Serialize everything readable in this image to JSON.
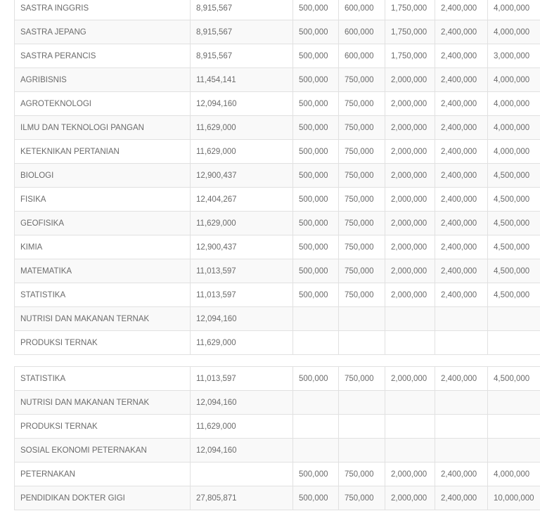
{
  "tables": [
    {
      "rows": [
        {
          "program": "SASTRA INGGRIS",
          "ukt": "8,915,567",
          "g1": "500,000",
          "g2": "600,000",
          "g3": "1,750,000",
          "g4": "2,400,000",
          "g5": "4,000,000"
        },
        {
          "program": "SASTRA JEPANG",
          "ukt": "8,915,567",
          "g1": "500,000",
          "g2": "600,000",
          "g3": "1,750,000",
          "g4": "2,400,000",
          "g5": "4,000,000"
        },
        {
          "program": "SASTRA PERANCIS",
          "ukt": "8,915,567",
          "g1": "500,000",
          "g2": "600,000",
          "g3": "1,750,000",
          "g4": "2,400,000",
          "g5": "3,000,000"
        },
        {
          "program": "AGRIBISNIS",
          "ukt": "11,454,141",
          "g1": "500,000",
          "g2": "750,000",
          "g3": "2,000,000",
          "g4": "2,400,000",
          "g5": "4,000,000"
        },
        {
          "program": "AGROTEKNOLOGI",
          "ukt": "12,094,160",
          "g1": "500,000",
          "g2": "750,000",
          "g3": "2,000,000",
          "g4": "2,400,000",
          "g5": "4,000,000"
        },
        {
          "program": "ILMU DAN TEKNOLOGI PANGAN",
          "ukt": "11,629,000",
          "g1": "500,000",
          "g2": "750,000",
          "g3": "2,000,000",
          "g4": "2,400,000",
          "g5": "4,000,000"
        },
        {
          "program": "KETEKNIKAN PERTANIAN",
          "ukt": "11,629,000",
          "g1": "500,000",
          "g2": "750,000",
          "g3": "2,000,000",
          "g4": "2,400,000",
          "g5": "4,000,000"
        },
        {
          "program": "BIOLOGI",
          "ukt": "12,900,437",
          "g1": "500,000",
          "g2": "750,000",
          "g3": "2,000,000",
          "g4": "2,400,000",
          "g5": "4,500,000"
        },
        {
          "program": "FISIKA",
          "ukt": "12,404,267",
          "g1": "500,000",
          "g2": "750,000",
          "g3": "2,000,000",
          "g4": "2,400,000",
          "g5": "4,500,000"
        },
        {
          "program": "GEOFISIKA",
          "ukt": "11,629,000",
          "g1": "500,000",
          "g2": "750,000",
          "g3": "2,000,000",
          "g4": "2,400,000",
          "g5": "4,500,000"
        },
        {
          "program": "KIMIA",
          "ukt": "12,900,437",
          "g1": "500,000",
          "g2": "750,000",
          "g3": "2,000,000",
          "g4": "2,400,000",
          "g5": "4,500,000"
        },
        {
          "program": "MATEMATIKA",
          "ukt": "11,013,597",
          "g1": "500,000",
          "g2": "750,000",
          "g3": "2,000,000",
          "g4": "2,400,000",
          "g5": "4,500,000"
        },
        {
          "program": "STATISTIKA",
          "ukt": "11,013,597",
          "g1": "500,000",
          "g2": "750,000",
          "g3": "2,000,000",
          "g4": "2,400,000",
          "g5": "4,500,000"
        },
        {
          "program": "NUTRISI DAN MAKANAN TERNAK",
          "ukt": "12,094,160",
          "g1": "",
          "g2": "",
          "g3": "",
          "g4": "",
          "g5": ""
        },
        {
          "program": "PRODUKSI TERNAK",
          "ukt": "11,629,000",
          "g1": "",
          "g2": "",
          "g3": "",
          "g4": "",
          "g5": ""
        }
      ]
    },
    {
      "rows": [
        {
          "program": "STATISTIKA",
          "ukt": "11,013,597",
          "g1": "500,000",
          "g2": "750,000",
          "g3": "2,000,000",
          "g4": "2,400,000",
          "g5": "4,500,000"
        },
        {
          "program": "NUTRISI DAN MAKANAN TERNAK",
          "ukt": "12,094,160",
          "g1": "",
          "g2": "",
          "g3": "",
          "g4": "",
          "g5": ""
        },
        {
          "program": "PRODUKSI TERNAK",
          "ukt": "11,629,000",
          "g1": "",
          "g2": "",
          "g3": "",
          "g4": "",
          "g5": ""
        },
        {
          "program": "SOSIAL EKONOMI PETERNAKAN",
          "ukt": "12,094,160",
          "g1": "",
          "g2": "",
          "g3": "",
          "g4": "",
          "g5": ""
        },
        {
          "program": "PETERNAKAN",
          "ukt": "",
          "g1": "500,000",
          "g2": "750,000",
          "g3": "2,000,000",
          "g4": "2,400,000",
          "g5": "4,000,000"
        },
        {
          "program": "PENDIDIKAN DOKTER GIGI",
          "ukt": "27,805,871",
          "g1": "500,000",
          "g2": "750,000",
          "g3": "2,000,000",
          "g4": "2,400,000",
          "g5": "10,000,000"
        }
      ]
    }
  ]
}
